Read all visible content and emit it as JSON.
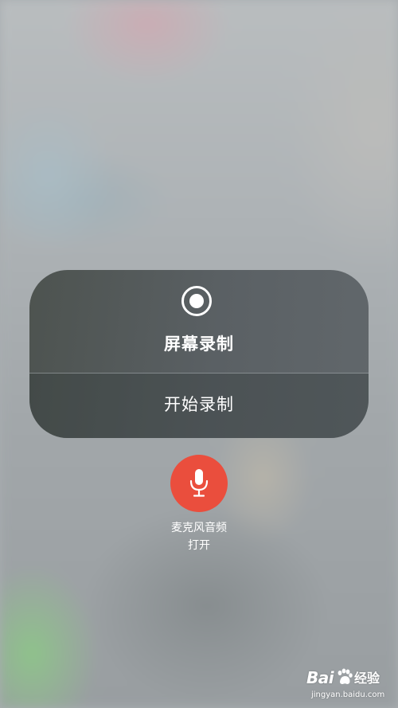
{
  "screen_recording": {
    "title": "屏幕录制",
    "start_label": "开始录制",
    "icon": "record-icon"
  },
  "microphone": {
    "label": "麦克风音频",
    "status": "打开",
    "icon": "microphone-icon",
    "color": "#ea4e3d"
  },
  "watermark": {
    "brand_left": "Bai",
    "brand_right": "经验",
    "url": "jingyan.baidu.com"
  }
}
